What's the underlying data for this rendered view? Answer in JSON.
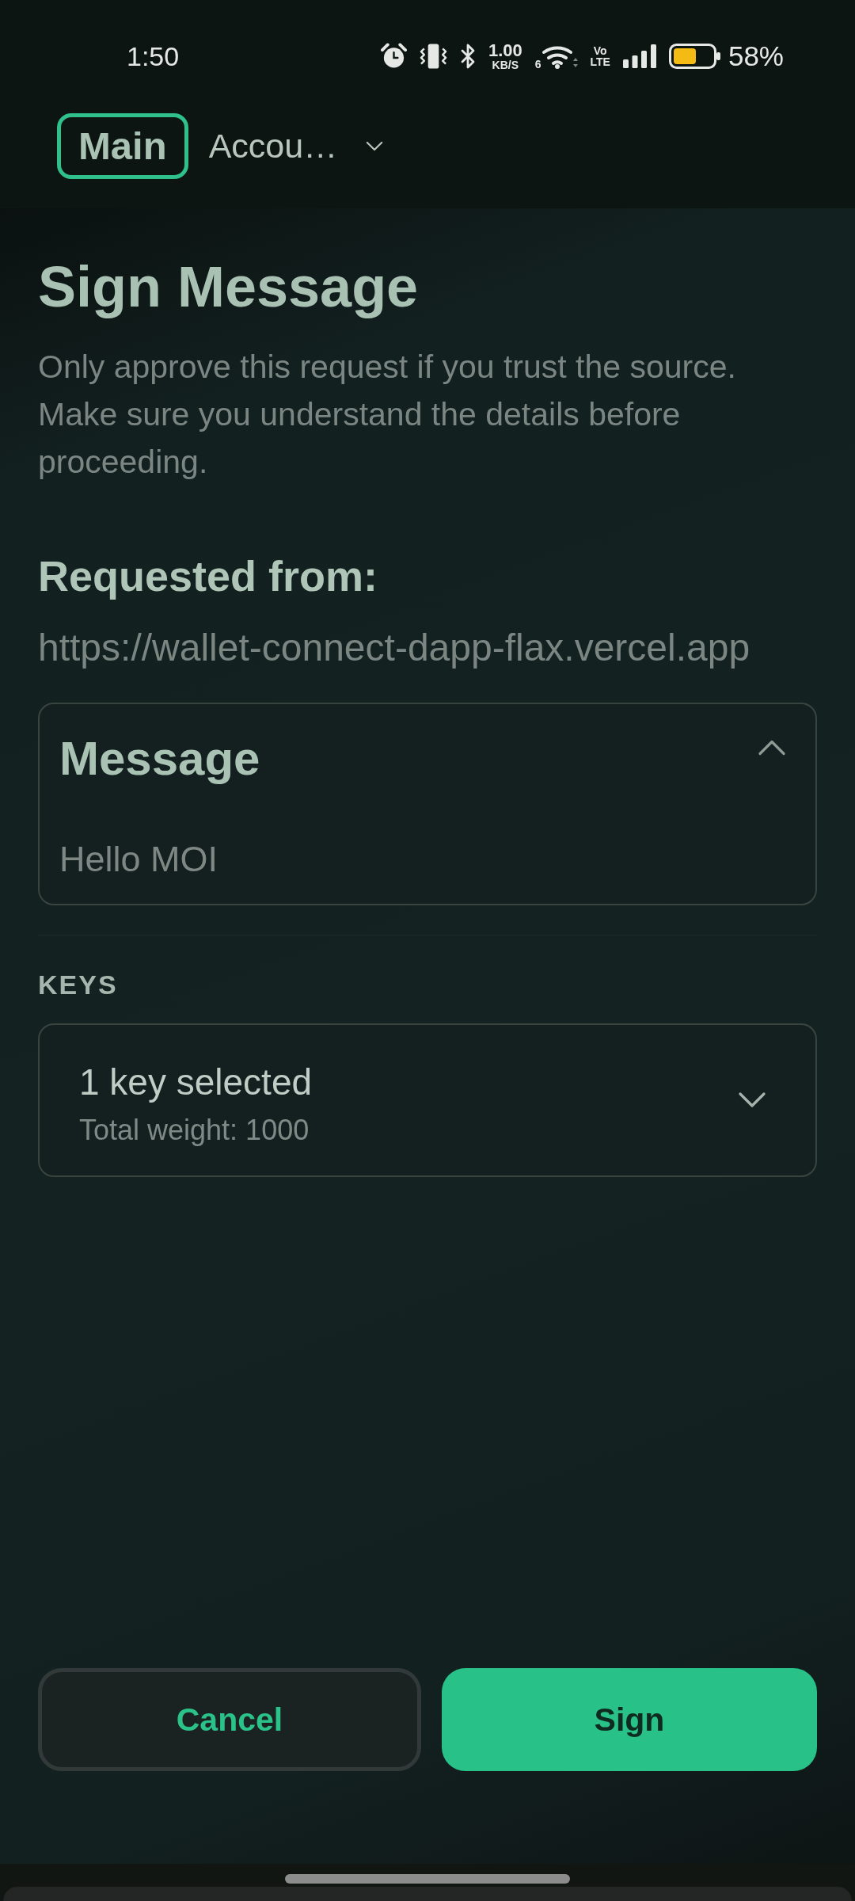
{
  "status_bar": {
    "time": "1:50",
    "network_speed": "1.00",
    "network_speed_unit": "KB/S",
    "wifi_generation": "6",
    "volte_top": "Vo",
    "volte_bottom": "LTE",
    "battery_percent": "58%"
  },
  "header": {
    "badge": "Main",
    "account_selector": {
      "label": "Accou…",
      "expanded": false
    }
  },
  "title": "Sign Message",
  "description": "Only approve this request if you trust the source. Make sure you understand the details before proceeding.",
  "requested_from": {
    "label": "Requested from:",
    "url": "https://wallet-connect-dapp-flax.vercel.app"
  },
  "message": {
    "title": "Message",
    "expanded": true,
    "body": "Hello MOI"
  },
  "keys": {
    "label": "KEYS",
    "selector": {
      "title": "1 key selected",
      "subtitle": "Total weight: 1000",
      "expanded": false
    }
  },
  "buttons": [
    {
      "label": "Cancel",
      "kind": "secondary"
    },
    {
      "label": "Sign",
      "kind": "primary"
    }
  ]
}
